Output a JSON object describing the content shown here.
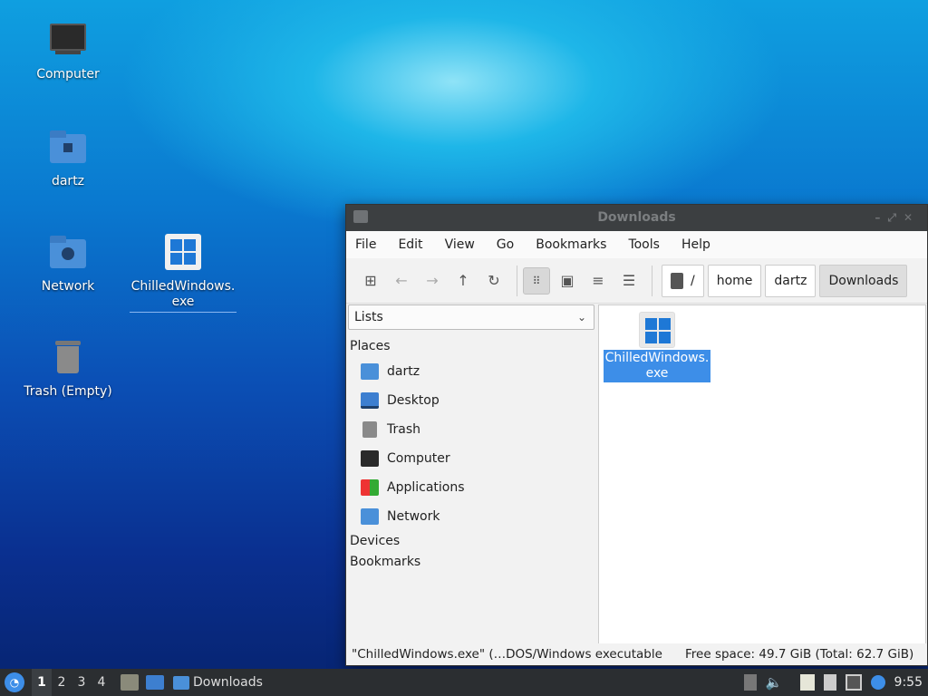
{
  "desktop": {
    "icons": [
      {
        "label": "Computer"
      },
      {
        "label": "dartz"
      },
      {
        "label": "Network"
      },
      {
        "label": "ChilledWindows.\nexe"
      },
      {
        "label": "Trash (Empty)"
      }
    ]
  },
  "window": {
    "title": "Downloads",
    "menu": [
      "File",
      "Edit",
      "View",
      "Go",
      "Bookmarks",
      "Tools",
      "Help"
    ],
    "toolbar": {
      "new_window_icon": "new-window-icon",
      "back_icon": "back-arrow-icon",
      "forward_icon": "forward-arrow-icon",
      "up_icon": "up-arrow-icon",
      "reload_icon": "reload-icon"
    },
    "path": [
      "/",
      "home",
      "dartz",
      "Downloads"
    ],
    "sidepane": {
      "combo_value": "Lists",
      "sections": {
        "places": "Places",
        "devices": "Devices",
        "bookmarks": "Bookmarks"
      },
      "places": [
        {
          "label": "dartz"
        },
        {
          "label": "Desktop"
        },
        {
          "label": "Trash"
        },
        {
          "label": "Computer"
        },
        {
          "label": "Applications"
        },
        {
          "label": "Network"
        }
      ]
    },
    "files": [
      {
        "name": "ChilledWindows.\nexe",
        "selected": true
      }
    ],
    "status": {
      "left": "\"ChilledWindows.exe\" (…DOS/Windows executable",
      "right": "Free space: 49.7 GiB (Total: 62.7 GiB)"
    }
  },
  "taskbar": {
    "workspaces": [
      "1",
      "2",
      "3",
      "4"
    ],
    "active_workspace": "1",
    "task_label": "Downloads",
    "clock": "9:55"
  },
  "colors": {
    "selection": "#3d8ee8",
    "taskbar": "#2b2e31",
    "titlebar": "#3c3f41"
  }
}
